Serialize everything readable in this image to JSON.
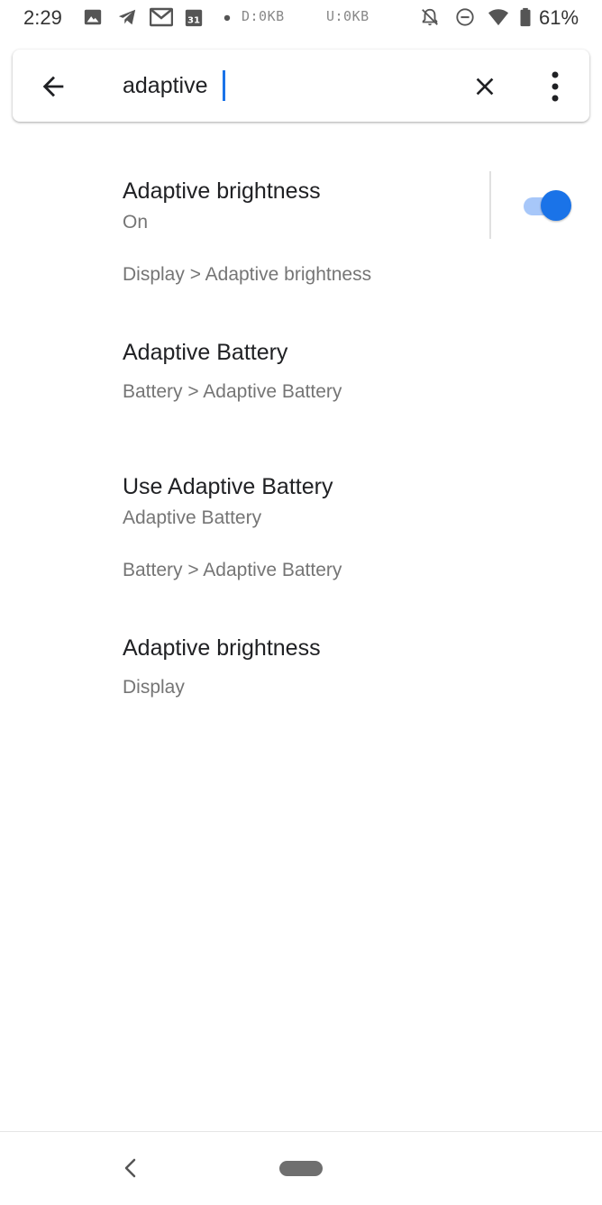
{
  "status_bar": {
    "time": "2:29",
    "download": "D:0KB",
    "upload": "U:0KB",
    "battery_percent": "61%",
    "calendar_day": "31",
    "icons": [
      "image-icon",
      "telegram-icon",
      "gmail-icon",
      "calendar-icon",
      "dot-icon",
      "notifications-off-icon",
      "do-not-disturb-icon",
      "wifi-icon",
      "battery-icon"
    ]
  },
  "search": {
    "query": "adaptive",
    "icons": {
      "back": "arrow-back-icon",
      "clear": "close-icon",
      "more": "more-vert-icon"
    }
  },
  "results": [
    {
      "title": "Adaptive brightness",
      "summary": "On",
      "path": "Display > Adaptive brightness",
      "toggle": true
    },
    {
      "title": "Adaptive Battery",
      "path": "Battery > Adaptive Battery"
    },
    {
      "title": "Use Adaptive Battery",
      "summary": "Adaptive Battery",
      "path": "Battery > Adaptive Battery"
    },
    {
      "title": "Adaptive brightness",
      "path": "Display"
    }
  ],
  "colors": {
    "accent": "#1a73e8",
    "toggle_track": "#a7c7f9",
    "primary_text": "#202124",
    "secondary_text": "#757575"
  }
}
